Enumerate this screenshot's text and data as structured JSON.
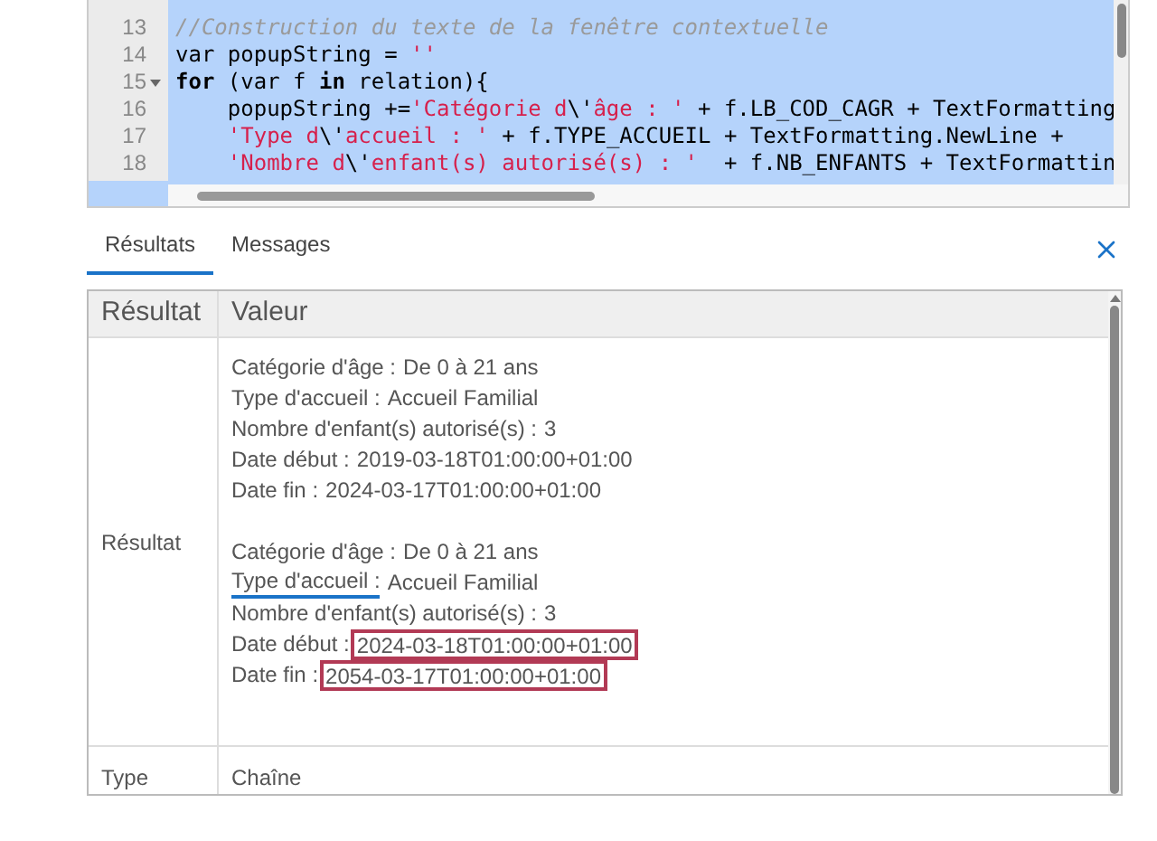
{
  "editor": {
    "lines": [
      {
        "number": "13",
        "fold": false,
        "tokens": [
          {
            "kind": "comment",
            "text": "//Construction du texte de la fenêtre contextuelle"
          }
        ]
      },
      {
        "number": "14",
        "fold": false,
        "tokens": [
          {
            "kind": "plain",
            "text": "var popupString = "
          },
          {
            "kind": "string",
            "text": "''"
          }
        ]
      },
      {
        "number": "15",
        "fold": true,
        "tokens": [
          {
            "kind": "keyword",
            "text": "for"
          },
          {
            "kind": "plain",
            "text": " (var f "
          },
          {
            "kind": "keyword",
            "text": "in"
          },
          {
            "kind": "plain",
            "text": " relation){"
          }
        ]
      },
      {
        "number": "16",
        "fold": false,
        "tokens": [
          {
            "kind": "plain",
            "text": "    popupString +="
          },
          {
            "kind": "string",
            "text": "'Catégorie d"
          },
          {
            "kind": "plain",
            "text": "\\'"
          },
          {
            "kind": "string",
            "text": "âge : '"
          },
          {
            "kind": "plain",
            "text": " + f.LB_COD_CAGR + TextFormatting"
          }
        ]
      },
      {
        "number": "17",
        "fold": false,
        "tokens": [
          {
            "kind": "string",
            "text": "    'Type d"
          },
          {
            "kind": "plain",
            "text": "\\'"
          },
          {
            "kind": "string",
            "text": "accueil : '"
          },
          {
            "kind": "plain",
            "text": " + f.TYPE_ACCUEIL + TextFormatting.NewLine +"
          }
        ]
      },
      {
        "number": "18",
        "fold": false,
        "tokens": [
          {
            "kind": "string",
            "text": "    'Nombre d"
          },
          {
            "kind": "plain",
            "text": "\\'"
          },
          {
            "kind": "string",
            "text": "enfant(s) autorisé(s) : '"
          },
          {
            "kind": "plain",
            "text": "  + f.NB_ENFANTS + TextFormattin"
          }
        ]
      }
    ]
  },
  "tabs": [
    {
      "label": "Résultats",
      "selected": true
    },
    {
      "label": "Messages",
      "selected": false
    }
  ],
  "table": {
    "columns": [
      "Résultat",
      "Valeur"
    ],
    "rows": [
      {
        "label": "Résultat",
        "groups": [
          [
            {
              "label": "Catégorie d'âge :",
              "value": "De 0 à 21 ans",
              "underlined": false,
              "boxed": false
            },
            {
              "label": "Type d'accueil :",
              "value": "Accueil Familial",
              "underlined": false,
              "boxed": false
            },
            {
              "label": "Nombre d'enfant(s) autorisé(s) :",
              "value": "3",
              "underlined": false,
              "boxed": false
            },
            {
              "label": "Date début :",
              "value": "2019-03-18T01:00:00+01:00",
              "underlined": false,
              "boxed": false
            },
            {
              "label": "Date fin :",
              "value": "2024-03-17T01:00:00+01:00",
              "underlined": false,
              "boxed": false
            }
          ],
          [
            {
              "label": "Catégorie d'âge :",
              "value": "De 0 à 21 ans",
              "underlined": false,
              "boxed": false
            },
            {
              "label": "Type d'accueil :",
              "value": "Accueil Familial",
              "underlined": true,
              "boxed": false
            },
            {
              "label": "Nombre d'enfant(s) autorisé(s) :",
              "value": "3",
              "underlined": false,
              "boxed": false
            },
            {
              "label": "Date début :",
              "value": "2024-03-18T01:00:00+01:00",
              "underlined": false,
              "boxed": true
            },
            {
              "label": "Date fin :",
              "value": "2054-03-17T01:00:00+01:00",
              "underlined": false,
              "boxed": true
            }
          ]
        ]
      },
      {
        "label": "Type",
        "text": "Chaîne"
      }
    ]
  }
}
